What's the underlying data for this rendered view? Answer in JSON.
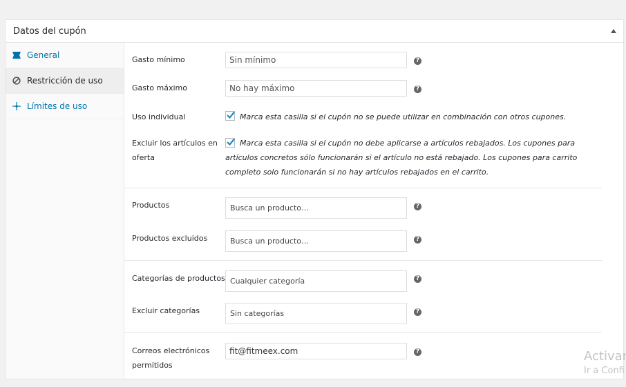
{
  "panel": {
    "title": "Datos del cupón"
  },
  "tabs": [
    {
      "label": "General",
      "icon": "ticket-icon"
    },
    {
      "label": "Restricción de uso",
      "icon": "ban-icon"
    },
    {
      "label": "Límites de uso",
      "icon": "arrows-icon"
    }
  ],
  "fields": {
    "min_spend": {
      "label": "Gasto mínimo",
      "placeholder": "Sin mínimo"
    },
    "max_spend": {
      "label": "Gasto máximo",
      "placeholder": "No hay máximo"
    },
    "individual_use": {
      "label": "Uso individual",
      "checked": true,
      "description": "Marca esta casilla si el cupón no se puede utilizar en combinación con otros cupones."
    },
    "exclude_sale": {
      "label": "Excluir los artículos en oferta",
      "checked": true,
      "description": "Marca esta casilla si el cupón no debe aplicarse a artículos rebajados. Los cupones para artículos concretos sólo funcionarán si el artículo no está rebajado. Los cupones para carrito completo solo funcionarán si no hay artículos rebajados en el carrito."
    },
    "products": {
      "label": "Productos",
      "placeholder": "Busca un producto…"
    },
    "excluded_products": {
      "label": "Productos excluidos",
      "placeholder": "Busca un producto…"
    },
    "product_categories": {
      "label": "Categorías de productos",
      "placeholder": "Cualquier categoría"
    },
    "exclude_categories": {
      "label": "Excluir categorías",
      "placeholder": "Sin categorías"
    },
    "allowed_emails": {
      "label": "Correos electrónicos permitidos",
      "value": "fit@fitmeex.com"
    }
  },
  "help_glyph": "?",
  "watermark": {
    "line1": "Activar",
    "line2": "Ir a Confi"
  }
}
